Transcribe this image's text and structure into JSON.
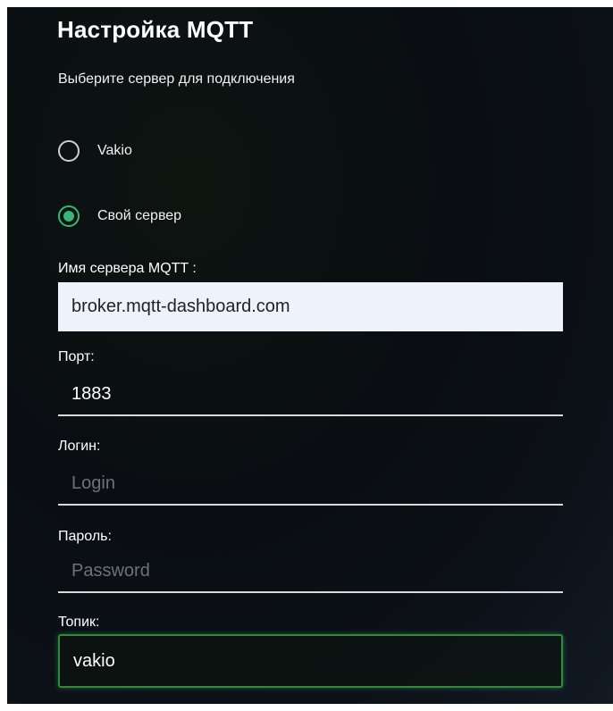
{
  "settings": {
    "title": "Настройка MQTT",
    "subtitle": "Выберите сервер для подключения",
    "server_options": [
      {
        "label": "Vakio",
        "selected": false
      },
      {
        "label": "Свой сервер",
        "selected": true
      }
    ],
    "fields": {
      "server_name": {
        "label": "Имя сервера MQTT :",
        "value": "broker.mqtt-dashboard.com",
        "placeholder": ""
      },
      "port": {
        "label": "Порт:",
        "value": "1883",
        "placeholder": ""
      },
      "login": {
        "label": "Логин:",
        "value": "",
        "placeholder": "Login"
      },
      "password": {
        "label": "Пароль:",
        "value": "",
        "placeholder": "Password"
      },
      "topic": {
        "label": "Топик:",
        "value": "vakio",
        "placeholder": ""
      }
    }
  },
  "colors": {
    "accent": "#34b877",
    "focus_border": "#2f8a3d",
    "background": "#0a0e12"
  }
}
